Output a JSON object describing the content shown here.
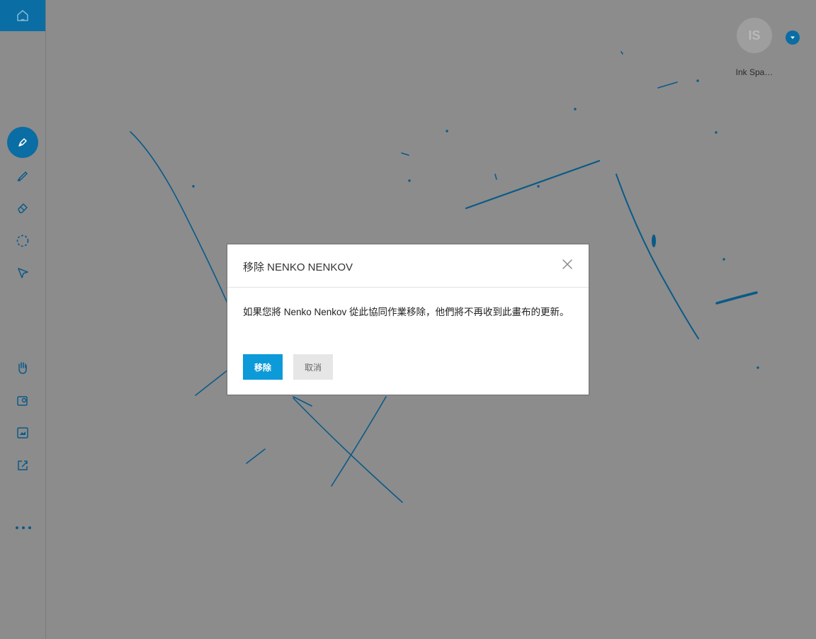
{
  "colors": {
    "accent": "#0a6da3",
    "button_primary": "#0c9ad9",
    "overlay": "#8c8c8c"
  },
  "toolbar": {
    "items": [
      {
        "name": "home",
        "icon": "home-icon"
      },
      {
        "name": "pen",
        "icon": "pen-icon",
        "active": true
      },
      {
        "name": "highlighter",
        "icon": "highlighter-icon"
      },
      {
        "name": "eraser",
        "icon": "eraser-icon"
      },
      {
        "name": "lasso-select",
        "icon": "lasso-icon"
      },
      {
        "name": "pointer",
        "icon": "pointer-icon"
      },
      {
        "name": "pan",
        "icon": "hand-icon"
      },
      {
        "name": "insert-image",
        "icon": "image-pin-icon"
      },
      {
        "name": "background",
        "icon": "picture-icon"
      },
      {
        "name": "share",
        "icon": "share-icon"
      },
      {
        "name": "more",
        "icon": "more-dots-icon"
      }
    ]
  },
  "user": {
    "initials": "IS",
    "name": "Ink Spa…"
  },
  "dialog": {
    "title": "移除 NENKO NENKOV",
    "message": "如果您將 Nenko Nenkov 從此協同作業移除，他們將不再收到此畫布的更新。",
    "confirm_label": "移除",
    "cancel_label": "取消",
    "close_icon": "close-icon"
  }
}
